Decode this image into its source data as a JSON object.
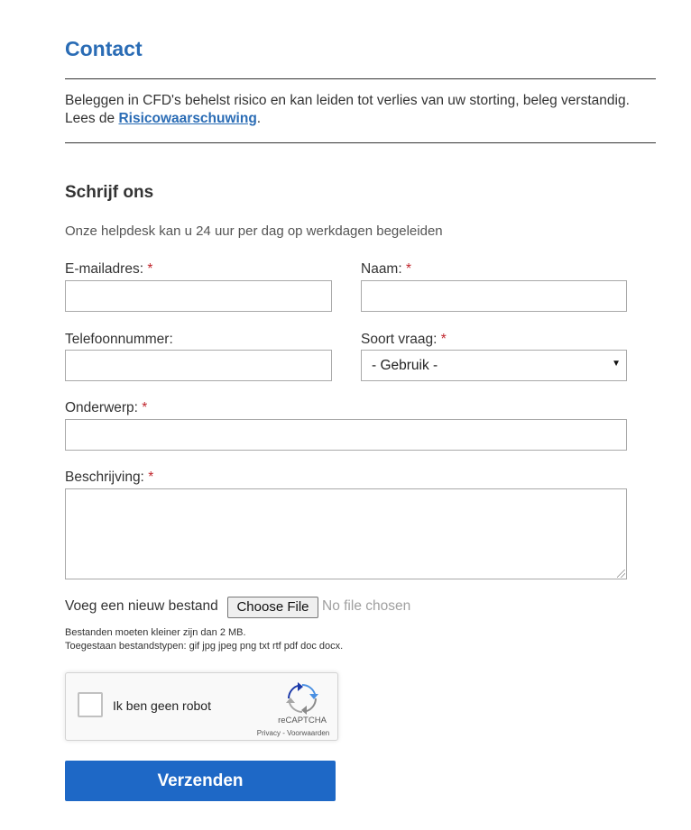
{
  "page": {
    "title": "Contact",
    "warning_text": "Beleggen in CFD's behelst risico en kan leiden tot verlies van uw storting, beleg verstandig. Lees de ",
    "warning_link": "Risicowaarschuwing",
    "warning_end": "."
  },
  "form": {
    "title": "Schrijf ons",
    "subtitle": "Onze helpdesk kan u 24 uur per dag op werkdagen begeleiden",
    "required_mark": "*",
    "email": {
      "label": "E-mailadres:",
      "value": "",
      "placeholder": ""
    },
    "name": {
      "label": "Naam:",
      "value": "",
      "placeholder": ""
    },
    "phone": {
      "label": "Telefoonnummer:",
      "value": "",
      "placeholder": ""
    },
    "question_type": {
      "label": "Soort vraag:",
      "selected": "- Gebruik -"
    },
    "subject": {
      "label": "Onderwerp:",
      "value": "",
      "placeholder": ""
    },
    "description": {
      "label": "Beschrijving:",
      "value": ""
    },
    "file": {
      "label": "Voeg een nieuw bestand",
      "button": "Choose File",
      "status": "No file chosen",
      "help_size": "Bestanden moeten kleiner zijn dan 2 MB.",
      "help_types": "Toegestaan bestandstypen: gif jpg jpeg png txt rtf pdf doc docx."
    },
    "recaptcha": {
      "label": "Ik ben geen robot",
      "brand": "reCAPTCHA",
      "terms": "Privacy - Voorwaarden"
    },
    "submit": "Verzenden"
  },
  "colors": {
    "accent": "#2a6cb5",
    "button": "#1e68c6",
    "required": "#c0262d"
  },
  "icons": {
    "recaptcha": "recaptcha-logo-icon",
    "select_arrow": "chevron-down-icon"
  }
}
